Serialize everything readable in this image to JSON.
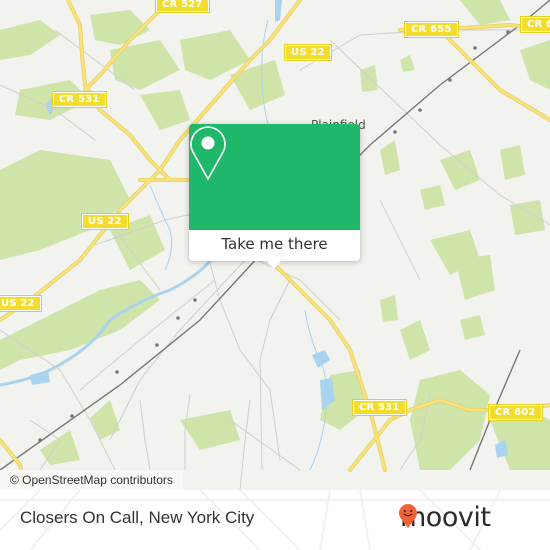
{
  "map": {
    "attribution": "© OpenStreetMap contributors",
    "place_labels": [
      {
        "text": "Plainfield"
      }
    ],
    "road_shields": [
      {
        "text": "CR 527"
      },
      {
        "text": "CR 531"
      },
      {
        "text": "US 22"
      },
      {
        "text": "CR 655"
      },
      {
        "text": "CR 6"
      },
      {
        "text": "US 22"
      },
      {
        "text": "US 22"
      },
      {
        "text": "CR 531"
      },
      {
        "text": "CR 602"
      }
    ],
    "colors": {
      "land": "#f2f2ee",
      "park": "#cfe4a9",
      "water": "#a9d3ee",
      "road_major": "#f6e27a",
      "road_minor": "#cfcfcf",
      "rail": "#777777"
    }
  },
  "popup": {
    "icon": "map-pin-icon",
    "button_label": "Take me there",
    "color": "#1fb86b"
  },
  "footer": {
    "place_name": "Closers On Call, New York City",
    "brand": "moovit",
    "brand_icon": "moovit-smiley-pin-icon",
    "brand_color": "#f0643a"
  }
}
